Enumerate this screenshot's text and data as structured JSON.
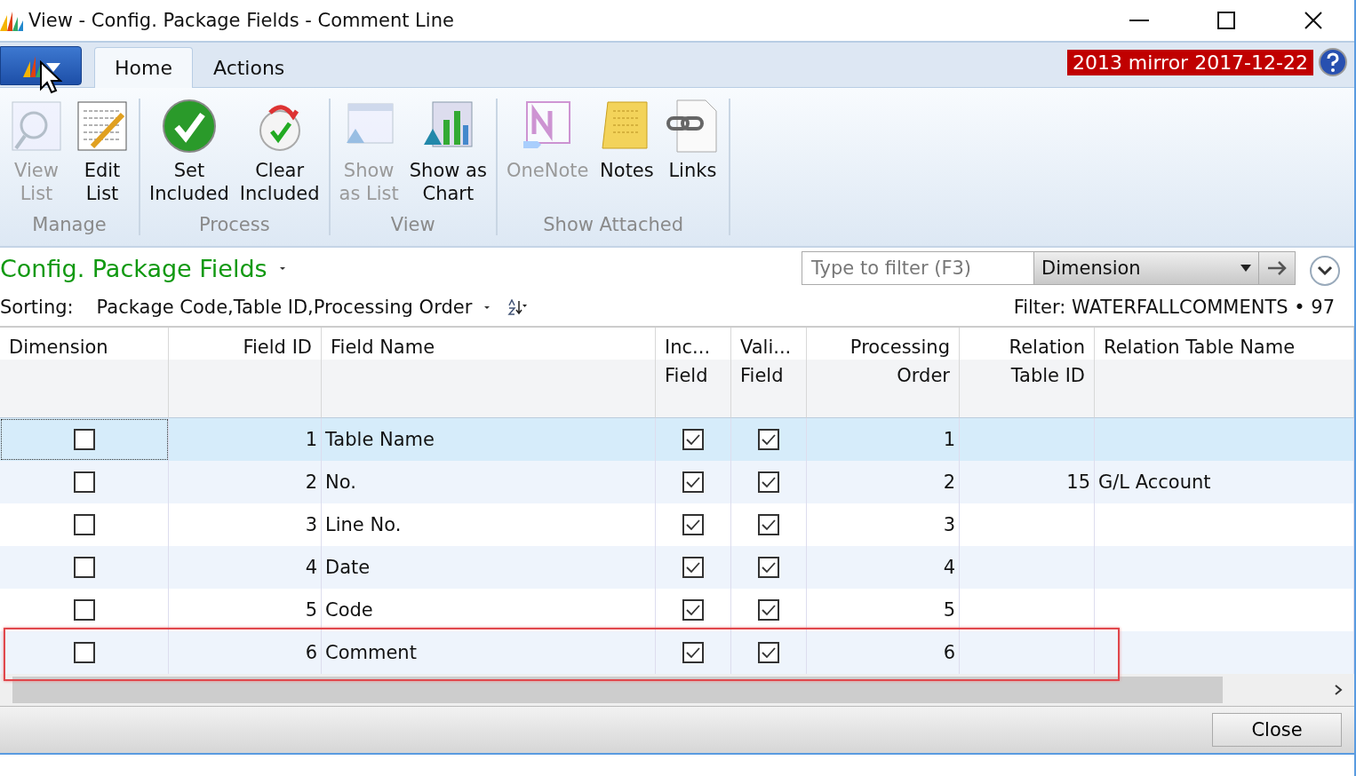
{
  "window": {
    "title": "View - Config. Package Fields - Comment Line"
  },
  "tabs": [
    {
      "label": "Home",
      "selected": true
    },
    {
      "label": "Actions",
      "selected": false
    }
  ],
  "badge": "2013 mirror 2017-12-22",
  "ribbon_groups": [
    {
      "label": "Manage",
      "buttons": [
        {
          "label": "View\nList",
          "kind": "viewlist",
          "disabled": true
        },
        {
          "label": "Edit\nList",
          "kind": "editlist",
          "disabled": false
        }
      ]
    },
    {
      "label": "Process",
      "buttons": [
        {
          "label": "Set\nIncluded",
          "kind": "set",
          "disabled": false
        },
        {
          "label": "Clear\nIncluded",
          "kind": "clear",
          "disabled": false
        }
      ]
    },
    {
      "label": "View",
      "buttons": [
        {
          "label": "Show\nas List",
          "kind": "list",
          "disabled": true
        },
        {
          "label": "Show as\nChart",
          "kind": "chart",
          "disabled": false
        }
      ]
    },
    {
      "label": "Show Attached",
      "buttons": [
        {
          "label": "OneNote",
          "kind": "onenote",
          "disabled": true
        },
        {
          "label": "Notes",
          "kind": "notes",
          "disabled": false
        },
        {
          "label": "Links",
          "kind": "links",
          "disabled": false
        }
      ]
    }
  ],
  "page": {
    "title": "Config. Package Fields",
    "sorting_label": "Sorting:",
    "sorting_value": "Package Code,Table ID,Processing Order",
    "filter": {
      "placeholder": "Type to filter (F3)",
      "field": "Dimension"
    },
    "filter_info": "Filter: WATERFALLCOMMENTS • 97"
  },
  "table": {
    "columns": [
      "Dimension",
      "Field ID",
      "Field Name",
      "Inc...\nField",
      "Vali...\nField",
      "Processing\nOrder",
      "Relation\nTable ID",
      "Relation Table Name"
    ],
    "rows": [
      {
        "dimension": false,
        "field_id": "1",
        "field_name": "Table Name",
        "include": true,
        "validate": true,
        "order": "1",
        "relation_id": "",
        "relation_name": "",
        "selected": true,
        "highlighted": false
      },
      {
        "dimension": false,
        "field_id": "2",
        "field_name": "No.",
        "include": true,
        "validate": true,
        "order": "2",
        "relation_id": "15",
        "relation_name": "G/L Account",
        "selected": false,
        "highlighted": false
      },
      {
        "dimension": false,
        "field_id": "3",
        "field_name": "Line No.",
        "include": true,
        "validate": true,
        "order": "3",
        "relation_id": "",
        "relation_name": "",
        "selected": false,
        "highlighted": false
      },
      {
        "dimension": false,
        "field_id": "4",
        "field_name": "Date",
        "include": true,
        "validate": true,
        "order": "4",
        "relation_id": "",
        "relation_name": "",
        "selected": false,
        "highlighted": false
      },
      {
        "dimension": false,
        "field_id": "5",
        "field_name": "Code",
        "include": true,
        "validate": true,
        "order": "5",
        "relation_id": "",
        "relation_name": "",
        "selected": false,
        "highlighted": false
      },
      {
        "dimension": false,
        "field_id": "6",
        "field_name": "Comment",
        "include": true,
        "validate": true,
        "order": "6",
        "relation_id": "",
        "relation_name": "",
        "selected": false,
        "highlighted": true
      }
    ]
  },
  "buttons": [
    "Close"
  ]
}
